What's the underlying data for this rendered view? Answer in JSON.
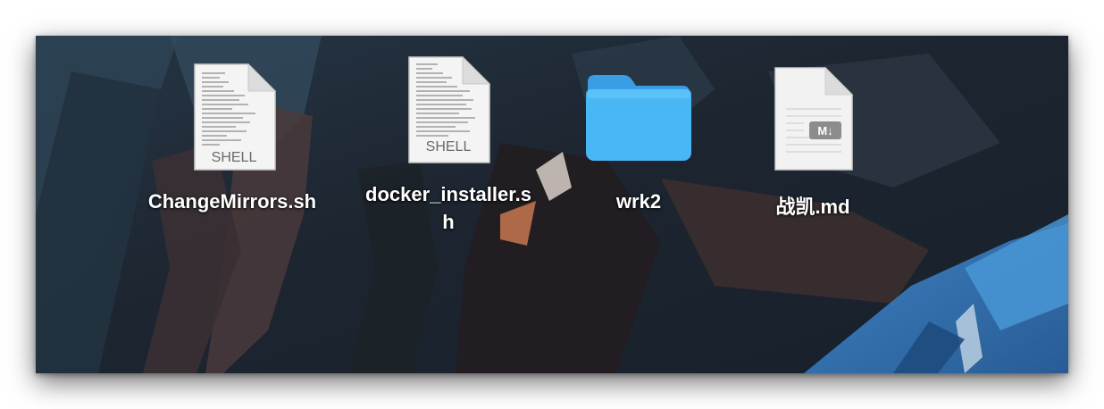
{
  "desktop": {
    "items": [
      {
        "name": "ChangeMirrors.sh",
        "kind": "shell-script",
        "badge": "SHELL"
      },
      {
        "name_lines": [
          "docker_installer.s",
          "h"
        ],
        "kind": "shell-script",
        "badge": "SHELL"
      },
      {
        "name": "wrk2",
        "kind": "folder"
      },
      {
        "name": "战凯.md",
        "kind": "markdown",
        "badge": "M↓"
      }
    ]
  },
  "colors": {
    "folder": "#4ab7f5",
    "label_text": "#ffffff",
    "wallpaper_base": "#1e2a36"
  },
  "icons": [
    "shell-document-icon",
    "shell-document-icon",
    "folder-icon",
    "markdown-document-icon"
  ]
}
